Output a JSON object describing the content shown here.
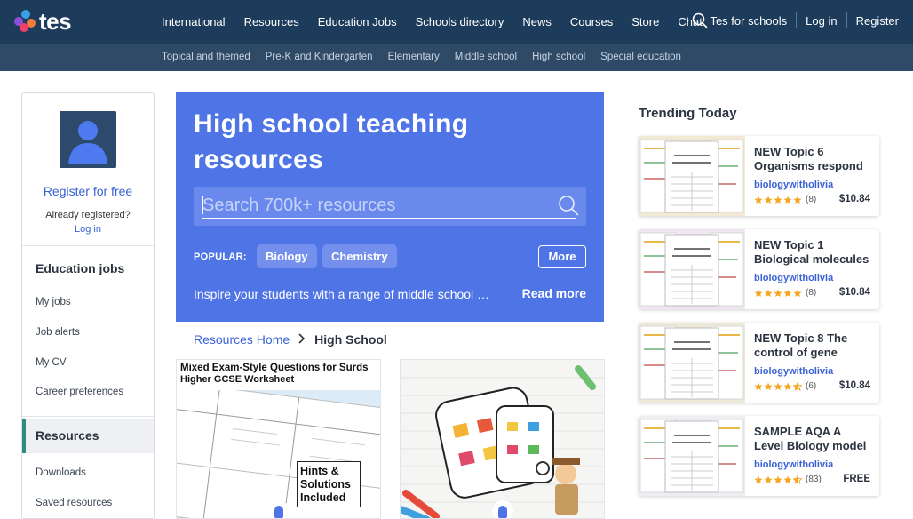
{
  "brand": {
    "name": "tes"
  },
  "nav": {
    "links": [
      "International",
      "Resources",
      "Education Jobs",
      "Schools directory",
      "News",
      "Courses",
      "Store",
      "Chat"
    ],
    "tes_for_schools": "Tes for schools",
    "login": "Log in",
    "register": "Register"
  },
  "subnav": {
    "links": [
      "Topical and themed",
      "Pre-K and Kindergarten",
      "Elementary",
      "Middle school",
      "High school",
      "Special education"
    ]
  },
  "sidebar": {
    "register_free": "Register for free",
    "already_registered": "Already registered?",
    "login": "Log in",
    "jobs_heading": "Education jobs",
    "jobs_items": [
      "My jobs",
      "Job alerts",
      "My CV",
      "Career preferences"
    ],
    "resources_heading": "Resources",
    "resources_items": [
      "Downloads",
      "Saved resources"
    ]
  },
  "hero": {
    "title": "High school teaching resources",
    "search_placeholder": "Search 700k+ resources",
    "popular_label": "POPULAR:",
    "chips": [
      "Biology",
      "Chemistry"
    ],
    "more": "More",
    "description": "Inspire your students with a range of middle school …",
    "read_more": "Read more"
  },
  "breadcrumb": {
    "home": "Resources Home",
    "current": "High School"
  },
  "cards": [
    {
      "heading": "Mixed Exam-Style Questions for Surds",
      "subheading": "Higher GCSE Worksheet",
      "badge_line1": "Hints &",
      "badge_line2": "Solutions",
      "badge_line3": "Included"
    },
    {
      "heading": ""
    }
  ],
  "trending": {
    "title": "Trending Today",
    "items": [
      {
        "title": "NEW Topic 6 Organisms respond",
        "author": "biologywitholivia",
        "rating": 5,
        "reviews": "(8)",
        "price": "$10.84"
      },
      {
        "title": "NEW Topic 1 Biological molecules",
        "author": "biologywitholivia",
        "rating": 5,
        "reviews": "(8)",
        "price": "$10.84"
      },
      {
        "title": "NEW Topic 8 The control of gene",
        "author": "biologywitholivia",
        "rating": 4.5,
        "reviews": "(6)",
        "price": "$10.84"
      },
      {
        "title": "SAMPLE AQA A Level Biology model",
        "author": "biologywitholivia",
        "rating": 4.5,
        "reviews": "(83)",
        "price": "FREE"
      }
    ]
  },
  "colors": {
    "nav": "#1d3b5a",
    "subnav": "#2f4a67",
    "hero": "#4f74e6",
    "link": "#3a62d6",
    "accent": "#2e8b7f",
    "star": "#f5a623"
  }
}
